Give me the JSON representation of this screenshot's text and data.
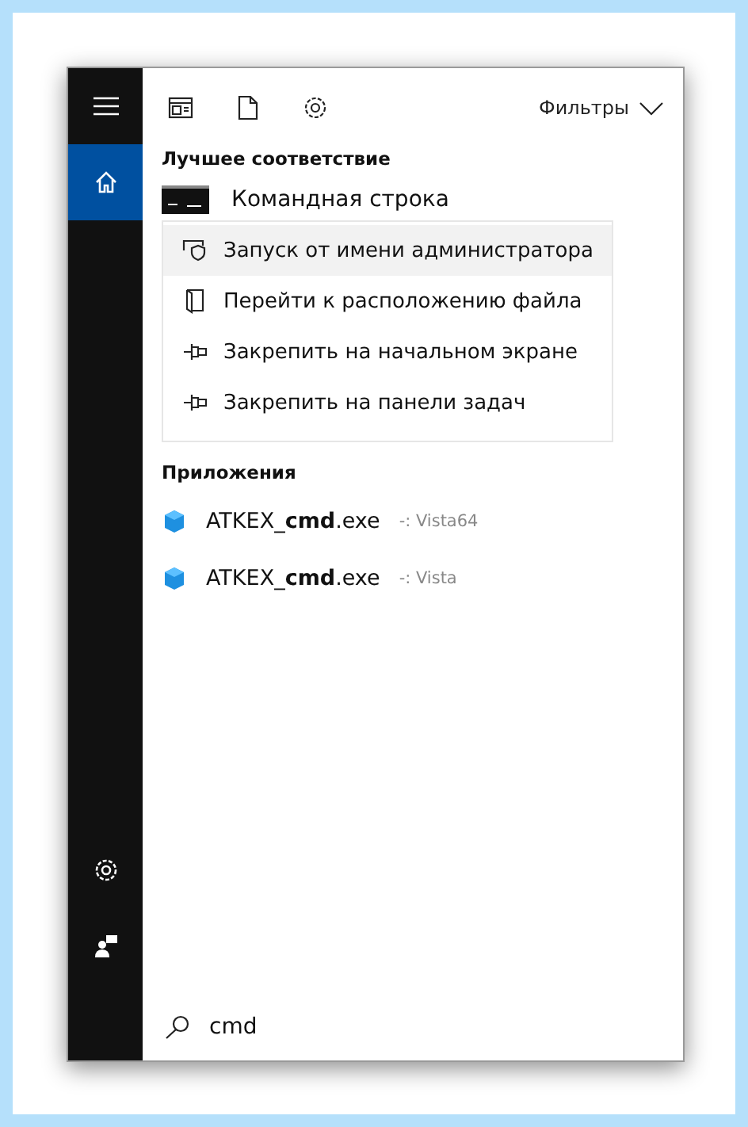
{
  "sidebar": {
    "items": [
      {
        "kind": "home",
        "selected": true
      },
      {
        "kind": "settings",
        "selected": false
      },
      {
        "kind": "feedback",
        "selected": false
      }
    ]
  },
  "toolbar": {
    "icons": [
      {
        "kind": "apps"
      },
      {
        "kind": "documents"
      },
      {
        "kind": "settings"
      }
    ],
    "filters": "Фильтры"
  },
  "best_match": {
    "heading": "Лучшее соответствие",
    "title": "Командная строка"
  },
  "context_menu": [
    {
      "kind": "admin",
      "label": "Запуск от имени администратора",
      "hovered": true
    },
    {
      "kind": "folder",
      "label": "Перейти к расположению файла",
      "hovered": false
    },
    {
      "kind": "pin",
      "label": "Закрепить на начальном экране",
      "hovered": false
    },
    {
      "kind": "pin",
      "label": "Закрепить на панели задач",
      "hovered": false
    }
  ],
  "apps": {
    "heading": "Приложения",
    "items": [
      {
        "name": "ATKEX_**cmd**.exe",
        "detail": "-: Vista64"
      },
      {
        "name": "ATKEX_**cmd**.exe",
        "detail": "-: Vista"
      }
    ]
  },
  "search": {
    "value": "cmd"
  }
}
